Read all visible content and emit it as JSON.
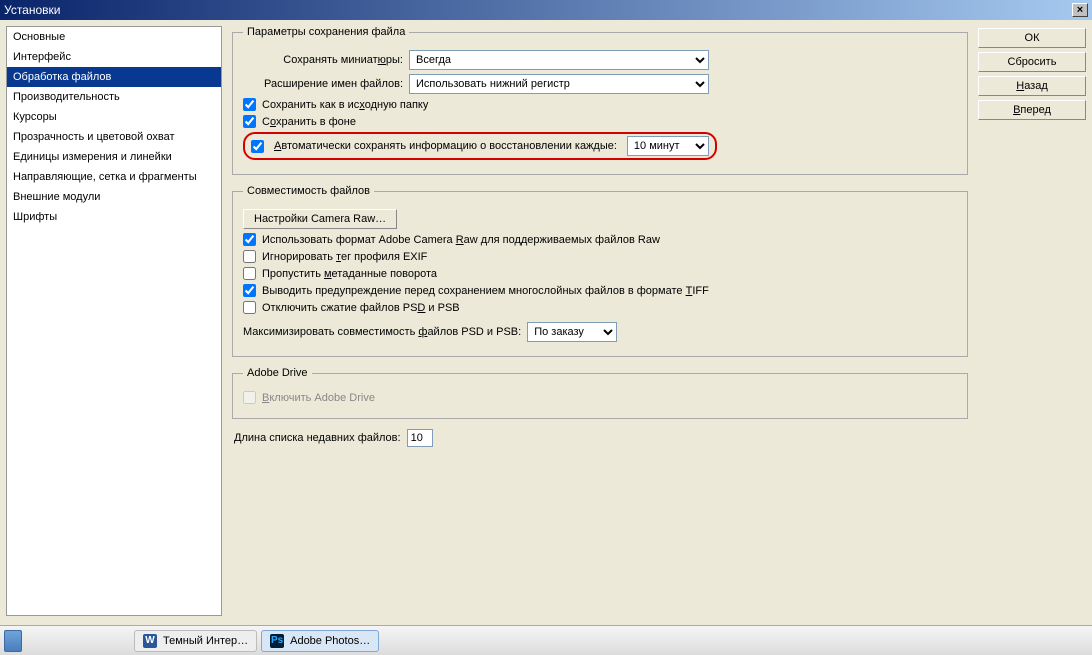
{
  "titlebar": {
    "title": "Установки",
    "close": "×"
  },
  "sidebar": {
    "items": [
      "Основные",
      "Интерфейс",
      "Обработка файлов",
      "Производительность",
      "Курсоры",
      "Прозрачность и цветовой охват",
      "Единицы измерения и линейки",
      "Направляющие, сетка и фрагменты",
      "Внешние модули",
      "Шрифты"
    ],
    "selectedIndex": 2
  },
  "buttons": {
    "ok": "ОК",
    "reset": "Сбросить",
    "back_pre": "",
    "back_u": "Н",
    "back_post": "азад",
    "fwd_pre": "",
    "fwd_u": "В",
    "fwd_post": "перед"
  },
  "fileSave": {
    "legend": "Параметры сохранения файла",
    "thumbLabel_pre": "Сохранять миниат",
    "thumbLabel_u": "ю",
    "thumbLabel_post": "ры:",
    "thumbValue": "Всегда",
    "extLabel": "Расширение имен файлов:",
    "extValue": "Использовать нижний регистр",
    "saveOrig_pre": "Сохранить как в ис",
    "saveOrig_u": "х",
    "saveOrig_post": "одную папку",
    "saveBg_pre": "С",
    "saveBg_u": "о",
    "saveBg_post": "хранить в фоне",
    "autoSave_pre": "",
    "autoSave_u": "А",
    "autoSave_post": "втоматически сохранять информацию о восстановлении каждые:",
    "autoSaveValue": "10 минут"
  },
  "compat": {
    "legend": "Совместимость файлов",
    "cameraBtn": "Настройки Camera Raw…",
    "useRaw_pre": "Использовать формат Adobe Camera ",
    "useRaw_u": "R",
    "useRaw_post": "aw для поддерживаемых файлов Raw",
    "ignoreExif_pre": "Игнорировать ",
    "ignoreExif_u": "т",
    "ignoreExif_post": "ег профиля EXIF",
    "skipMeta_pre": "Пропустить ",
    "skipMeta_u": "м",
    "skipMeta_post": "етаданные поворота",
    "warnTiff_pre": "Выводить предупреждение перед сохранением многослойных файлов в формате ",
    "warnTiff_u": "T",
    "warnTiff_post": "IFF",
    "disableComp_pre": "Отключить сжатие файлов PS",
    "disableComp_u": "D",
    "disableComp_post": " и PSB",
    "maxLabel_pre": "Максимизировать совместимость ",
    "maxLabel_u": "ф",
    "maxLabel_post": "айлов PSD и PSB:",
    "maxValue": "По заказу"
  },
  "adobeDrive": {
    "legend": "Adobe Drive",
    "enable_pre": "",
    "enable_u": "В",
    "enable_post": "ключить Adobe Drive"
  },
  "recent": {
    "label_pre": "",
    "recent_u": "Д",
    "label_post": "лина списка недавних файлов:",
    "value": "10"
  },
  "taskbar": {
    "item1": "Темный Интер…",
    "item2": "Adobe Photos…"
  }
}
